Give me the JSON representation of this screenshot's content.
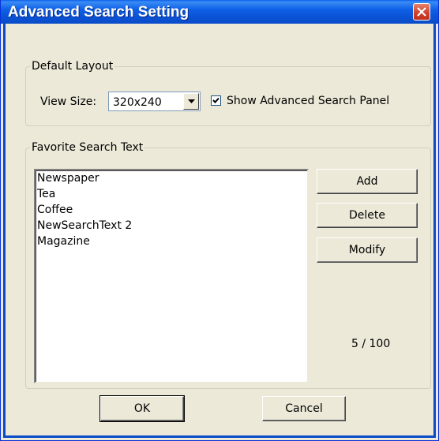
{
  "window": {
    "title": "Advanced Search Setting",
    "close_icon": "close-icon"
  },
  "default_layout": {
    "group_title": "Default Layout",
    "view_size_label": "View Size:",
    "view_size_value": "320x240",
    "show_panel_label": "Show Advanced Search Panel",
    "show_panel_checked": true
  },
  "favorites": {
    "group_title": "Favorite Search Text",
    "items": [
      "Newspaper",
      "Tea",
      "Coffee",
      "NewSearchText 2",
      "Magazine"
    ],
    "add_label": "Add",
    "delete_label": "Delete",
    "modify_label": "Modify",
    "count_text": "5 / 100"
  },
  "footer": {
    "ok_label": "OK",
    "cancel_label": "Cancel"
  },
  "colors": {
    "titlebar": "#0A4CC8",
    "dialog_bg": "#ECE9D8",
    "close_button": "#D0412B"
  }
}
